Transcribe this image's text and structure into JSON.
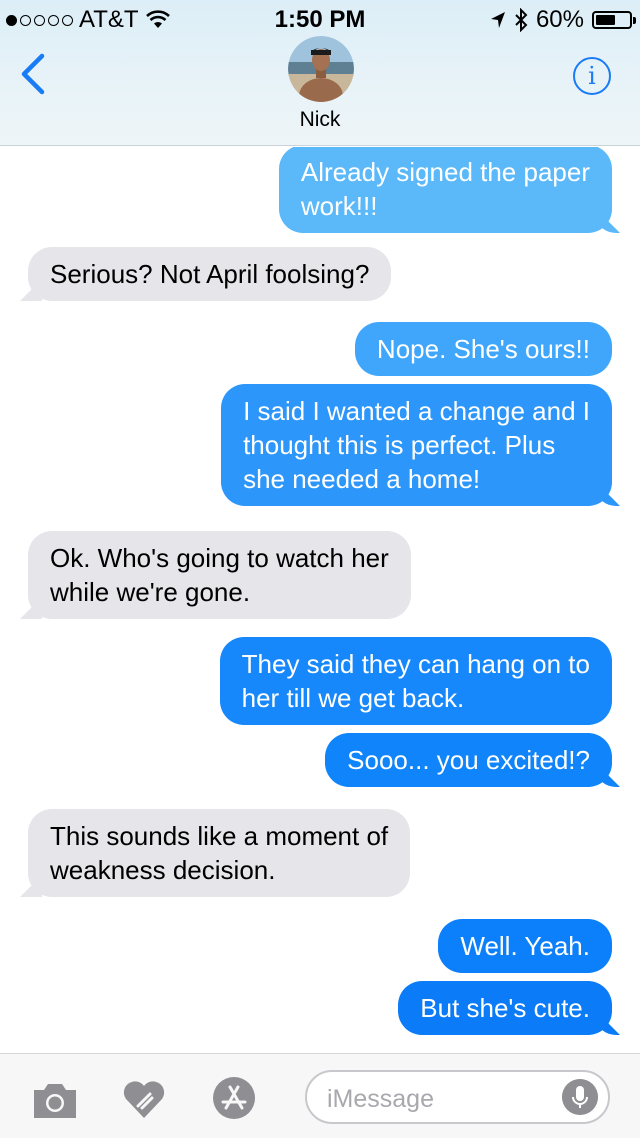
{
  "status_bar": {
    "carrier": "AT&T",
    "time": "1:50 PM",
    "battery": "60%",
    "battery_level": 0.6
  },
  "header": {
    "back_icon": "chevron-left-icon",
    "contact_name": "Nick",
    "info_icon": "i",
    "accent": "#1a7cf5"
  },
  "messages": [
    {
      "dir": "out",
      "text": "Already signed the paper\nwork!!!"
    },
    {
      "dir": "in",
      "text": "Serious? Not April foolsing?"
    },
    {
      "dir": "out",
      "text": "Nope. She's ours!!"
    },
    {
      "dir": "out",
      "text": "I said I wanted a change and I\nthought this is perfect. Plus\nshe needed a home!"
    },
    {
      "dir": "in",
      "text": "Ok. Who's going to watch her\nwhile we're gone."
    },
    {
      "dir": "out",
      "text": "They said they can hang on to\nher till we get back."
    },
    {
      "dir": "out",
      "text": "Sooo... you excited!?"
    },
    {
      "dir": "in",
      "text": "This sounds like a moment of\nweakness decision."
    },
    {
      "dir": "out",
      "text": "Well. Yeah."
    },
    {
      "dir": "out",
      "text": "But she's cute."
    }
  ],
  "input_bar": {
    "placeholder": "iMessage",
    "icons": [
      "camera-icon",
      "digital-touch-icon",
      "app-store-icon",
      "microphone-icon"
    ]
  },
  "colors": {
    "outgoing_top": "#5ac8fa",
    "outgoing_bottom": "#0b7bff",
    "incoming": "#e5e5ea"
  }
}
